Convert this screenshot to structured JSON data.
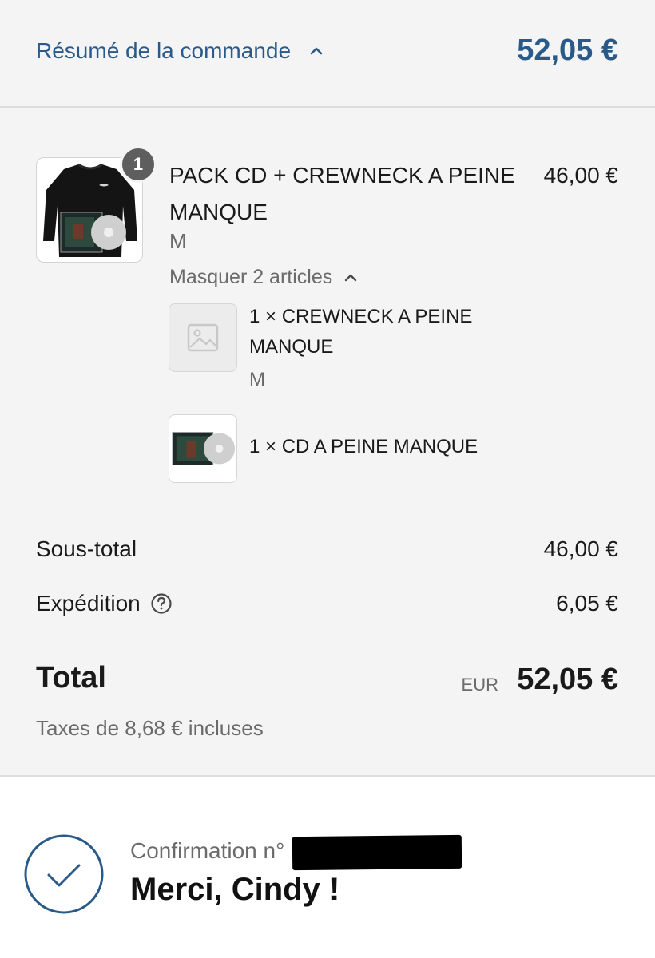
{
  "header": {
    "summary_label": "Résumé de la commande",
    "total": "52,05 €"
  },
  "product": {
    "quantity_badge": "1",
    "name": "PACK CD + CREWNECK A PEINE MANQUE",
    "price": "46,00 €",
    "variant": "M",
    "hide_items_label": "Masquer 2 articles",
    "sub_items": [
      {
        "label": "1 × CREWNECK A PEINE MANQUE",
        "variant": "M",
        "thumb_icon": "image-placeholder-icon"
      },
      {
        "label": "1 × CD A PEINE MANQUE",
        "variant": "",
        "thumb_icon": "cd-cover-image"
      }
    ]
  },
  "totals": {
    "subtotal_label": "Sous-total",
    "subtotal_value": "46,00 €",
    "shipping_label": "Expédition",
    "shipping_value": "6,05 €",
    "total_label": "Total",
    "currency": "EUR",
    "total_value": "52,05 €",
    "taxes_note": "Taxes de 8,68 € incluses"
  },
  "confirmation": {
    "number_label": "Confirmation n°",
    "thank_you": "Merci, Cindy !"
  },
  "colors": {
    "accent": "#2a5a8a",
    "panel_bg": "#f4f4f4",
    "muted_text": "#6b6b6b"
  }
}
